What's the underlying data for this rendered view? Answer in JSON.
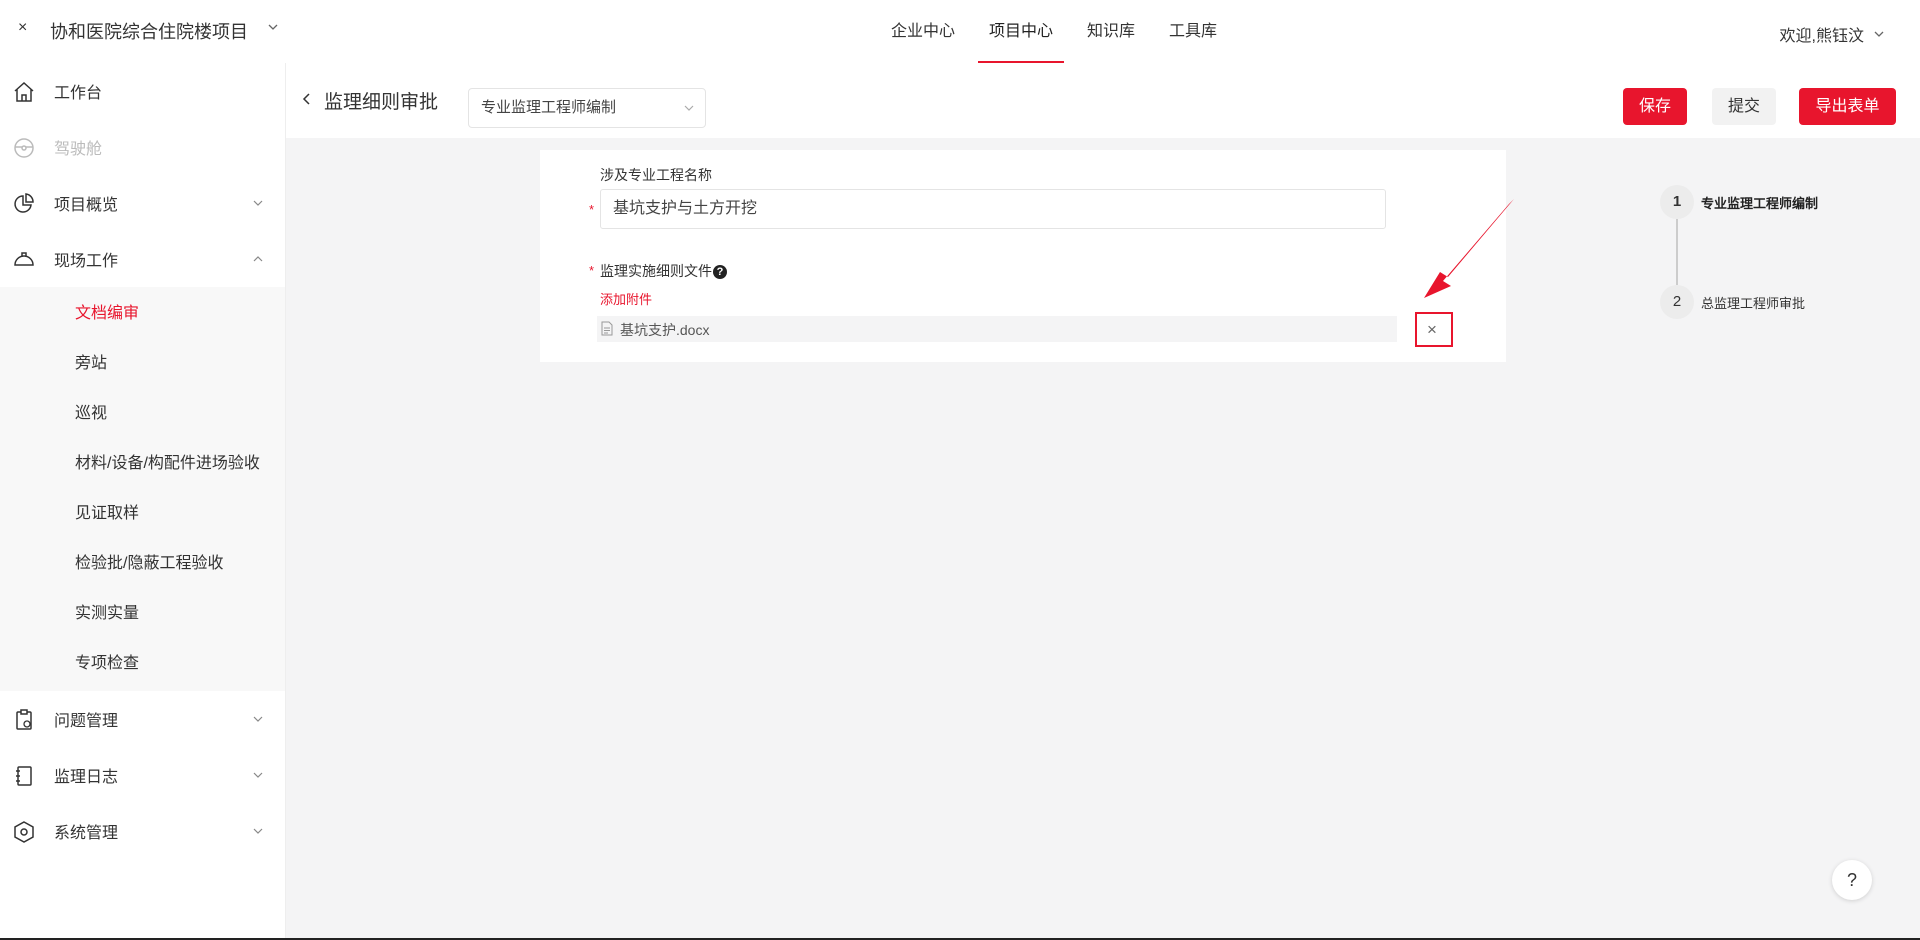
{
  "project": {
    "close_glyph": "×",
    "name": "协和医院综合住院楼项目"
  },
  "top_nav": [
    {
      "label": "企业中心",
      "active": false
    },
    {
      "label": "项目中心",
      "active": true
    },
    {
      "label": "知识库",
      "active": false
    },
    {
      "label": "工具库",
      "active": false
    }
  ],
  "welcome": "欢迎,熊钰汶",
  "sidebar": {
    "items": [
      {
        "label": "工作台",
        "icon": "home-icon"
      },
      {
        "label": "驾驶舱",
        "icon": "steering-wheel-icon",
        "disabled": true
      },
      {
        "label": "项目概览",
        "icon": "pie-chart-icon"
      },
      {
        "label": "现场工作",
        "icon": "helmet-icon",
        "expanded": true
      },
      {
        "label": "问题管理",
        "icon": "clipboard-icon"
      },
      {
        "label": "监理日志",
        "icon": "notebook-icon"
      },
      {
        "label": "系统管理",
        "icon": "hexagon-settings-icon"
      }
    ],
    "sub_items": [
      {
        "label": "文档编审",
        "active": true
      },
      {
        "label": "旁站"
      },
      {
        "label": "巡视"
      },
      {
        "label": "材料/设备/构配件进场验收"
      },
      {
        "label": "见证取样"
      },
      {
        "label": "检验批/隐蔽工程验收"
      },
      {
        "label": "实测实量"
      },
      {
        "label": "专项检查"
      }
    ]
  },
  "page": {
    "title": "监理细则审批",
    "stage_select": "专业监理工程师编制",
    "buttons": {
      "save": "保存",
      "submit": "提交",
      "export": "导出表单"
    }
  },
  "form": {
    "project_name_label": "涉及专业工程名称",
    "required_mark": "*",
    "project_name_value": "基坑支护与土方开挖",
    "file_label": "监理实施细则文件",
    "help_glyph": "?",
    "add_attachment": "添加附件",
    "file_name": "基坑支护.docx",
    "delete_glyph": "×"
  },
  "steps": [
    {
      "number": "1",
      "label": "专业监理工程师编制",
      "active": true
    },
    {
      "number": "2",
      "label": "总监理工程师审批",
      "active": false
    }
  ],
  "help_button": "?",
  "colors": {
    "accent": "#e8152d",
    "background": "#f4f4f5"
  }
}
